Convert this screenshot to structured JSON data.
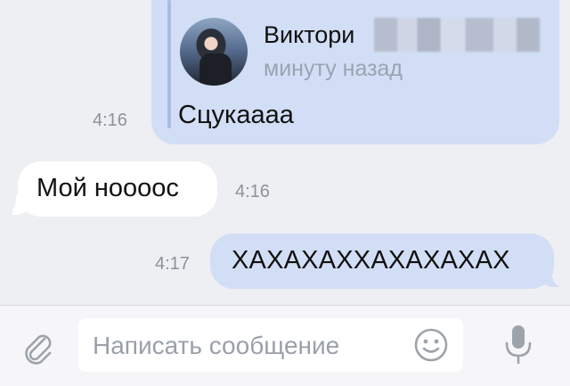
{
  "messages": [
    {
      "direction": "outgoing",
      "forwarded": {
        "sender_name": "Виктори",
        "sender_subtitle": "минуту назад",
        "text": "Сцукаааа"
      },
      "time": "4:16"
    },
    {
      "direction": "incoming",
      "text": "Мой нооооc",
      "time": "4:16"
    },
    {
      "direction": "outgoing",
      "text": "ХАХАХАХХАХАХАХАХ",
      "time": "4:17"
    }
  ],
  "composer": {
    "placeholder": "Написать сообщение",
    "attach_icon": "paperclip-icon",
    "emoji_icon": "smiley-icon",
    "mic_icon": "microphone-icon"
  },
  "colors": {
    "background": "#edeff3",
    "outgoing_bubble": "#d2def5",
    "incoming_bubble": "#ffffff",
    "forward_bar": "#a7bde6",
    "time_text": "#8d929a",
    "icon_gray": "#9ea3ab"
  }
}
